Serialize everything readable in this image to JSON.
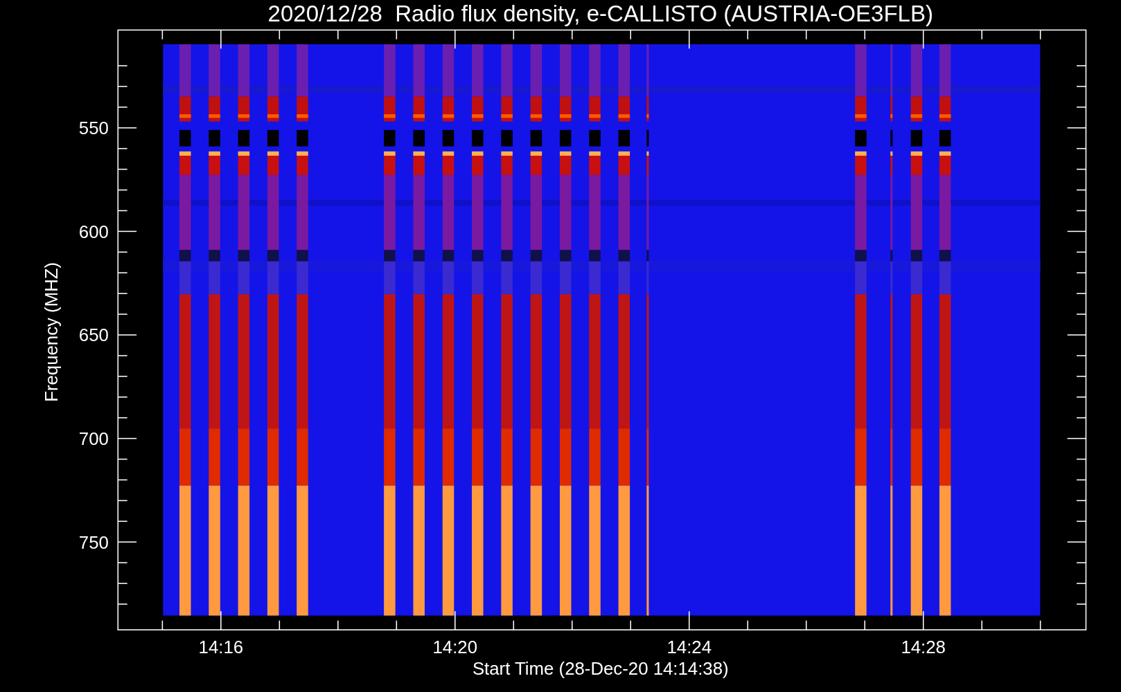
{
  "title": "2020/12/28  Radio flux density, e-CALLISTO (AUSTRIA-OE3FLB)",
  "ylabel": "Frequency (MHZ)",
  "xlabel": "Start Time (28-Dec-20 14:14:38)",
  "yticks": [
    "550",
    "600",
    "650",
    "700",
    "750"
  ],
  "xticks": [
    "14:16",
    "14:20",
    "14:24",
    "14:28"
  ]
}
